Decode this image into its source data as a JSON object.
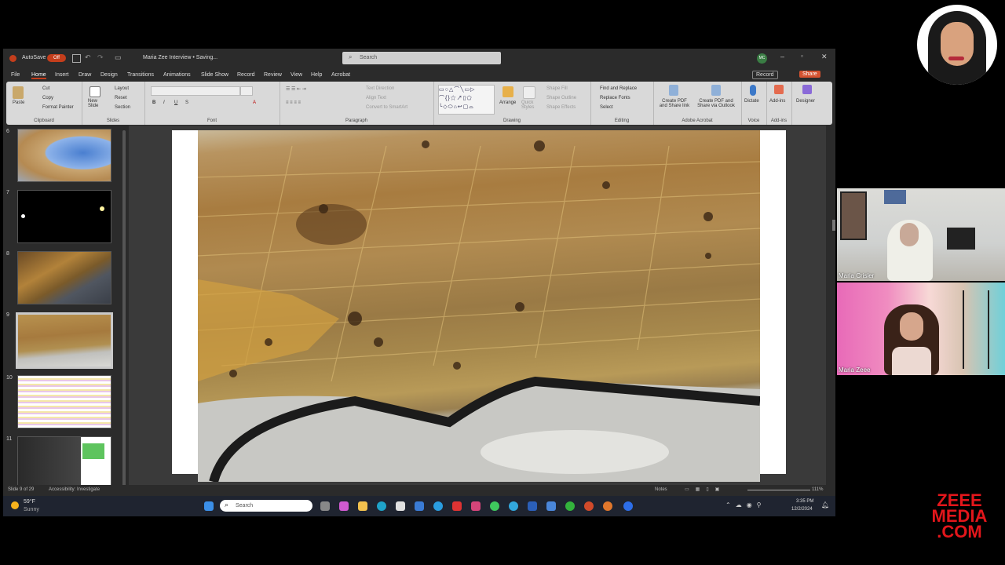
{
  "window": {
    "autosave_label": "AutoSave",
    "autosave_state": "Off",
    "doc_title": "Maria Zee Interview • Saving...",
    "search_placeholder": "Search",
    "user_initials": "MC"
  },
  "menu": {
    "items": [
      "File",
      "Home",
      "Insert",
      "Draw",
      "Design",
      "Transitions",
      "Animations",
      "Slide Show",
      "Record",
      "Review",
      "View",
      "Help",
      "Acrobat"
    ],
    "record_button": "Record",
    "share_button": "Share"
  },
  "ribbon": {
    "clipboard": {
      "paste": "Paste",
      "cut": "Cut",
      "copy": "Copy",
      "format_painter": "Format Painter",
      "label": "Clipboard"
    },
    "slides": {
      "new_slide": "New Slide",
      "layout": "Layout",
      "reset": "Reset",
      "section": "Section",
      "label": "Slides"
    },
    "font": {
      "label": "Font"
    },
    "paragraph": {
      "text_direction": "Text Direction",
      "align_text": "Align Text",
      "convert_smartart": "Convert to SmartArt",
      "label": "Paragraph"
    },
    "drawing": {
      "arrange": "Arrange",
      "quick_styles": "Quick Styles",
      "shape_fill": "Shape Fill",
      "shape_outline": "Shape Outline",
      "shape_effects": "Shape Effects",
      "label": "Drawing"
    },
    "editing": {
      "find_replace": "Find and Replace",
      "replace_fonts": "Replace Fonts",
      "select": "Select",
      "label": "Editing"
    },
    "acrobat": {
      "create_pdf_share": "Create PDF and Share link",
      "create_pdf_outlook": "Create PDF and Share via Outlook",
      "label": "Adobe Acrobat"
    },
    "voice": {
      "dictate": "Dictate",
      "label": "Voice"
    },
    "addins": {
      "addins": "Add-ins",
      "label": "Add-ins"
    },
    "designer": {
      "designer": "Designer"
    }
  },
  "thumbnails": [
    {
      "num": "6",
      "selected": false
    },
    {
      "num": "7",
      "selected": false
    },
    {
      "num": "8",
      "selected": false
    },
    {
      "num": "9",
      "selected": true
    },
    {
      "num": "10",
      "selected": false
    },
    {
      "num": "11",
      "selected": false
    }
  ],
  "status": {
    "slide_info": "Slide 9 of 29",
    "accessibility": "Accessibility: Investigate",
    "notes": "Notes",
    "zoom": "111%"
  },
  "taskbar": {
    "temperature": "59°F",
    "weather": "Sunny",
    "search_placeholder": "Search",
    "time": "3:35 PM",
    "date": "12/2/2024"
  },
  "participants": [
    {
      "name": "Maria Crisler"
    },
    {
      "name": "Maria Zeee"
    }
  ],
  "logo": {
    "line1": "ZEEE",
    "line2": "MEDIA",
    ".line3": "",
    "line3_text": ".COM"
  },
  "colors": {
    "accent": "#c43e1c",
    "logo_red": "#e3161b",
    "share": "#d35230"
  }
}
